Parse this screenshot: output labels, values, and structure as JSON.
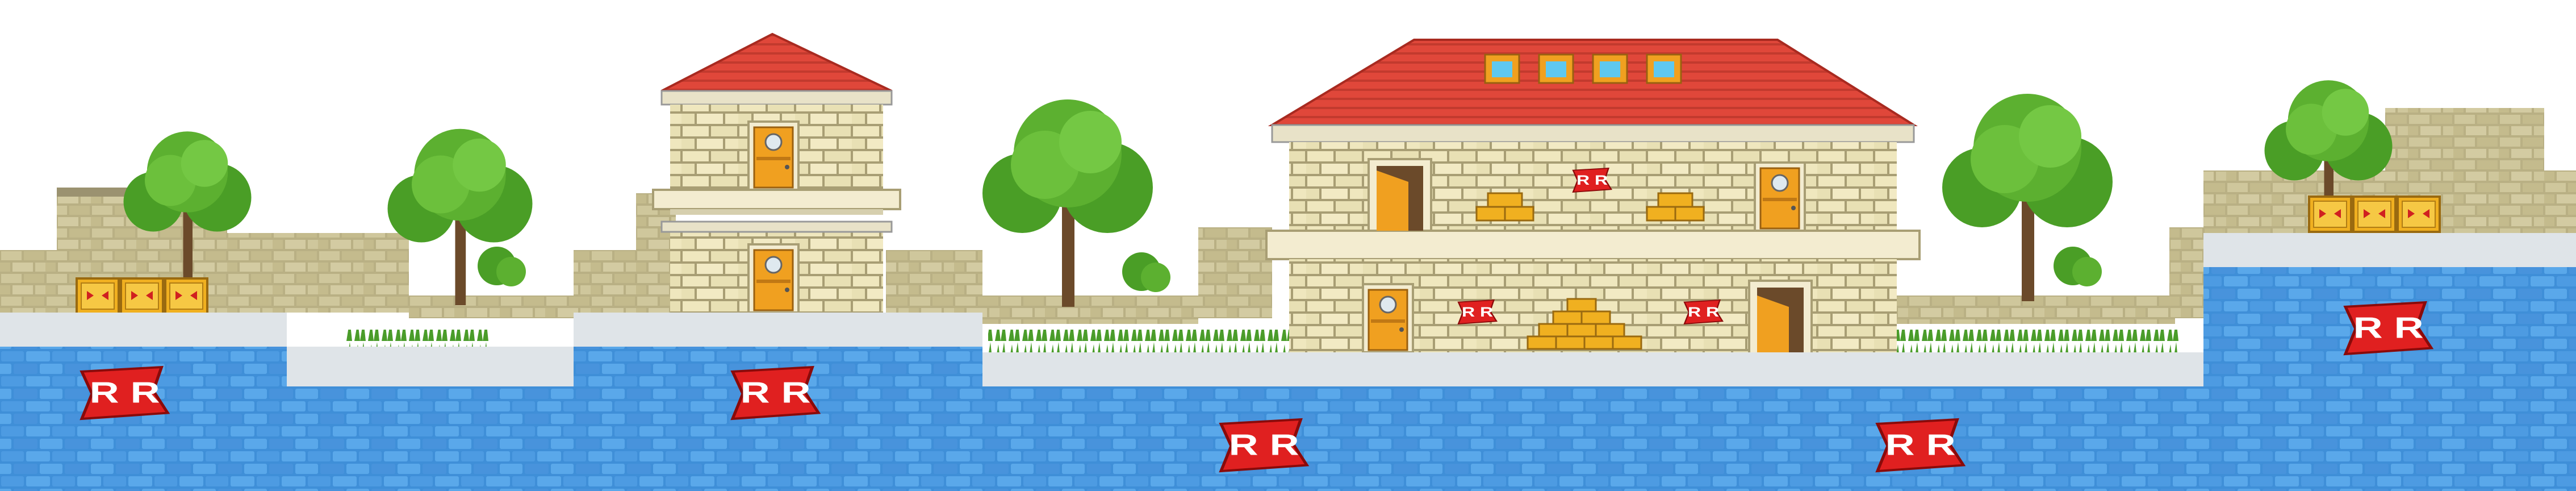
{
  "scene": {
    "type": "side-scrolling level background",
    "flag_text": "R R",
    "colors": {
      "sky": "#ffffff",
      "water_brick": "#3f8fd8",
      "water_brick_light": "#5aa8ea",
      "mortar": "#2f78c0",
      "walkway": "#dfe4e8",
      "stone": "#c8c094",
      "stone_dark": "#8f8760",
      "roof": "#e0473a",
      "roof_dark": "#b8322a",
      "door": "#f0a020",
      "tree": "#5cb030",
      "trunk": "#6b4a2a",
      "crate": "#f0b020",
      "flag": "#e02020"
    },
    "icons": [
      "red-ribbon-flag-icon",
      "crate-icon",
      "door-icon",
      "window-icon",
      "tree-icon",
      "bush-icon"
    ]
  }
}
